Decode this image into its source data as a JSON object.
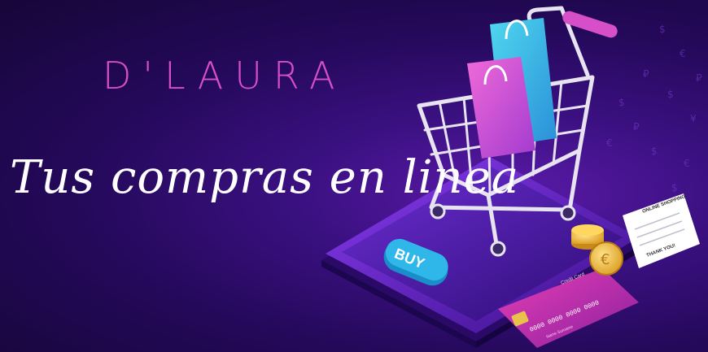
{
  "brand": {
    "name": "D'LAURA"
  },
  "tagline": "Tus compras en linea",
  "phone": {
    "buy_button_label": "BUY"
  },
  "receipt": {
    "title": "ONLINE SHOPPING",
    "footer": "THANK YOU!"
  },
  "card": {
    "brand_label": "Credit Card",
    "number": "0000 0000 0000 0000",
    "holder": "Name Surname"
  },
  "colors": {
    "accent": "#d64fc9",
    "background": "#24095a",
    "button": "#2fb7ea"
  }
}
